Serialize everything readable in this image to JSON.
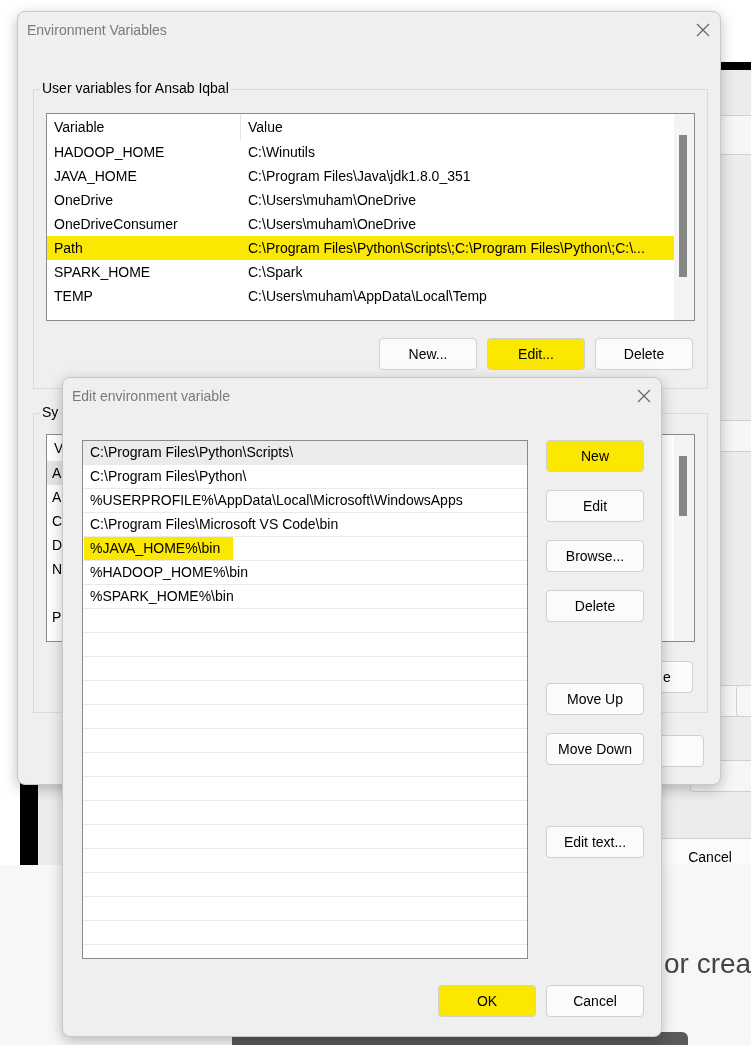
{
  "background": {
    "text_fragment": "or crea",
    "cancel_button": "Cancel"
  },
  "environment_dialog": {
    "title": "Environment Variables",
    "user_variables": {
      "title": "User variables for Ansab Iqbal",
      "columns": [
        "Variable",
        "Value"
      ],
      "rows": [
        {
          "variable": "HADOOP_HOME",
          "value": "C:\\Winutils",
          "highlighted": false
        },
        {
          "variable": "JAVA_HOME",
          "value": "C:\\Program Files\\Java\\jdk1.8.0_351",
          "highlighted": false
        },
        {
          "variable": "OneDrive",
          "value": "C:\\Users\\muham\\OneDrive",
          "highlighted": false
        },
        {
          "variable": "OneDriveConsumer",
          "value": "C:\\Users\\muham\\OneDrive",
          "highlighted": false
        },
        {
          "variable": "Path",
          "value": "C:\\Program Files\\Python\\Scripts\\;C:\\Program Files\\Python\\;C:\\...",
          "highlighted": true
        },
        {
          "variable": "SPARK_HOME",
          "value": "C:\\Spark",
          "highlighted": false
        },
        {
          "variable": "TEMP",
          "value": "C:\\Users\\muham\\AppData\\Local\\Temp",
          "highlighted": false
        }
      ],
      "buttons": [
        {
          "label": "New...",
          "highlighted": false
        },
        {
          "label": "Edit...",
          "highlighted": true
        },
        {
          "label": "Delete",
          "highlighted": false
        }
      ]
    },
    "system_variables": {
      "title": "Sy",
      "column": "V",
      "rows": [
        {
          "variable": "A",
          "selected": true
        },
        {
          "variable": "A",
          "selected": false
        },
        {
          "variable": "C",
          "selected": false
        },
        {
          "variable": "D",
          "selected": false
        },
        {
          "variable": "N",
          "selected": false
        },
        {
          "selected": false
        },
        {
          "variable": "P",
          "selected": false
        }
      ],
      "button_fragment": "e"
    }
  },
  "edit_dialog": {
    "title": "Edit environment variable",
    "entries": [
      {
        "text": "C:\\Program Files\\Python\\Scripts\\",
        "selected": true,
        "highlighted": false
      },
      {
        "text": "C:\\Program Files\\Python\\",
        "selected": false,
        "highlighted": false
      },
      {
        "text": "%USERPROFILE%\\AppData\\Local\\Microsoft\\WindowsApps",
        "selected": false,
        "highlighted": false
      },
      {
        "text": "C:\\Program Files\\Microsoft VS Code\\bin",
        "selected": false,
        "highlighted": false
      },
      {
        "text": "%JAVA_HOME%\\bin",
        "selected": false,
        "highlighted": true
      },
      {
        "text": "%HADOOP_HOME%\\bin",
        "selected": false,
        "highlighted": false
      },
      {
        "text": "%SPARK_HOME%\\bin",
        "selected": false,
        "highlighted": false
      }
    ],
    "side_buttons": [
      {
        "label": "New",
        "highlighted": true,
        "kind": "top"
      },
      {
        "label": "Edit",
        "highlighted": false,
        "kind": "top"
      },
      {
        "label": "Browse...",
        "highlighted": false,
        "kind": "top"
      },
      {
        "label": "Delete",
        "highlighted": false,
        "kind": "top"
      },
      {
        "label": "Move Up",
        "highlighted": false,
        "kind": "gap"
      },
      {
        "label": "Move Down",
        "highlighted": false,
        "kind": "top"
      },
      {
        "label": "Edit text...",
        "highlighted": false,
        "kind": "gap"
      }
    ],
    "footer_buttons": [
      {
        "label": "OK",
        "highlighted": true
      },
      {
        "label": "Cancel",
        "highlighted": false
      }
    ]
  }
}
